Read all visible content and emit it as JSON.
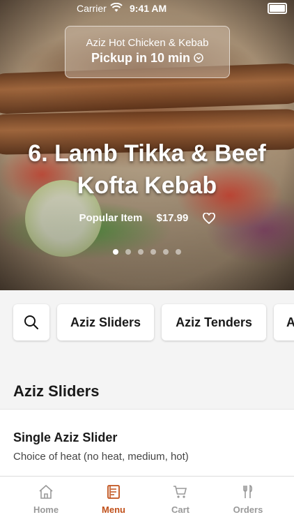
{
  "status_bar": {
    "carrier": "Carrier",
    "time": "9:41 AM"
  },
  "hero": {
    "store_name": "Aziz Hot Chicken & Kebab",
    "pickup_label": "Pickup in 10 min",
    "dish_title_line1": "6. Lamb Tikka & Beef",
    "dish_title_line2": "Kofta Kebab",
    "badge": "Popular Item",
    "price": "$17.99",
    "carousel_count": 6,
    "carousel_active": 0
  },
  "categories": {
    "items": [
      "Aziz Sliders",
      "Aziz Tenders",
      "A"
    ]
  },
  "section": {
    "title": "Aziz Sliders",
    "items": [
      {
        "name": "Single Aziz Slider",
        "description": "Choice of heat (no heat, medium, hot)"
      }
    ]
  },
  "tabbar": {
    "items": [
      {
        "label": "Home",
        "icon": "home-icon"
      },
      {
        "label": "Menu",
        "icon": "menu-icon"
      },
      {
        "label": "Cart",
        "icon": "cart-icon"
      },
      {
        "label": "Orders",
        "icon": "fork-knife-icon"
      }
    ],
    "active_color": "#c0501a",
    "inactive_color": "#999999"
  }
}
